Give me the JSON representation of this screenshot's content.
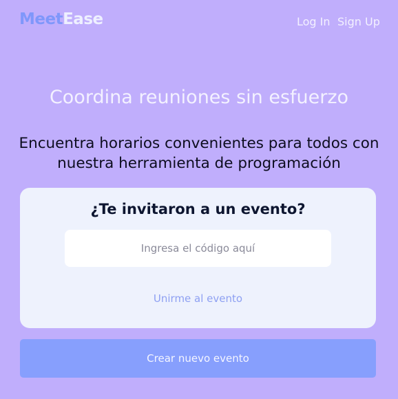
{
  "header": {
    "logo_part1": "Meet",
    "logo_part2": "Ease",
    "login_label": "Log In",
    "signup_label": "Sign Up"
  },
  "hero": {
    "title": "Coordina reuniones sin esfuerzo",
    "subtitle": "Encuentra horarios convenientes para todos con nuestra herramienta de programación"
  },
  "invite_card": {
    "title": "¿Te invitaron a un evento?",
    "code_placeholder": "Ingresa el código aquí",
    "join_label": "Unirme al evento"
  },
  "create_button_label": "Crear nuevo evento",
  "colors": {
    "background": "#c0aefc",
    "brand_primary": "#7f97fb",
    "card_background": "#eef2fd",
    "button_background": "#879ffd"
  }
}
